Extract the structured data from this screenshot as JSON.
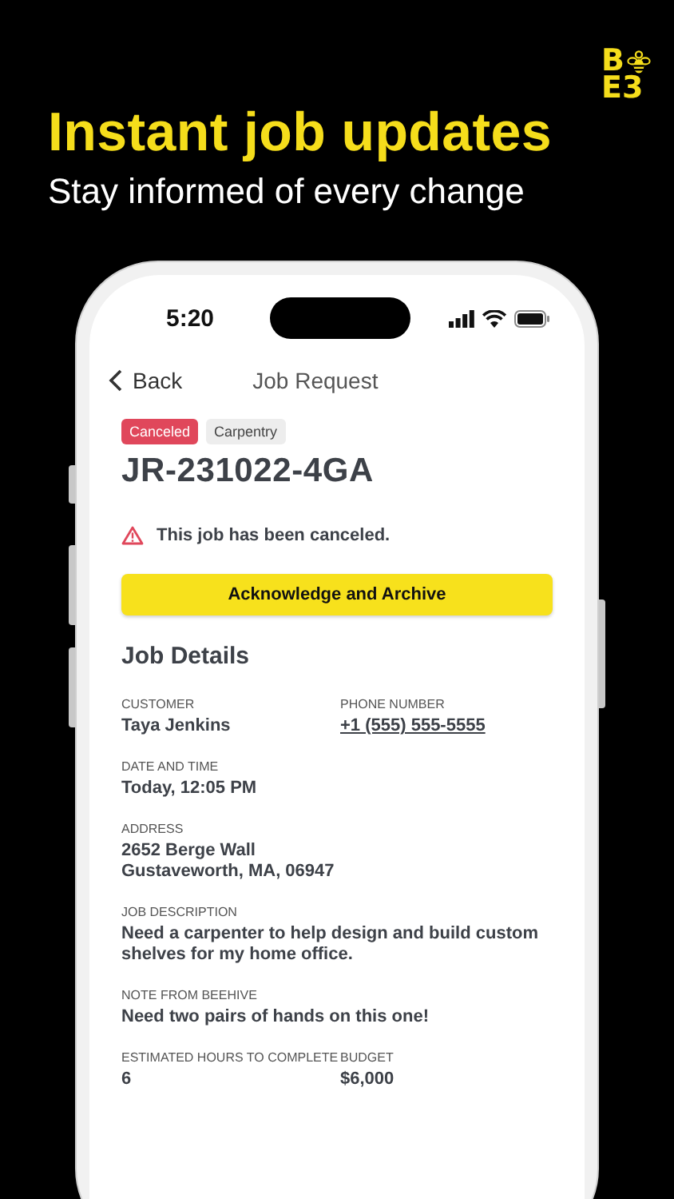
{
  "logo": {
    "top": "B",
    "bottom": "E3"
  },
  "headline": "Instant job updates",
  "subheadline": "Stay informed of every change",
  "status_bar": {
    "time": "5:20"
  },
  "nav": {
    "back": "Back",
    "title": "Job Request"
  },
  "tags": [
    {
      "label": "Canceled",
      "kind": "status"
    },
    {
      "label": "Carpentry",
      "kind": "category"
    }
  ],
  "job_id": "JR-231022-4GA",
  "alert": "This job has been canceled.",
  "action_button": "Acknowledge and Archive",
  "section_title": "Job Details",
  "detail_rows": [
    [
      {
        "label": "CUSTOMER",
        "value": "Taya Jenkins",
        "kind": "text"
      },
      {
        "label": "PHONE NUMBER",
        "value": "+1 (555) 555-5555",
        "kind": "link"
      }
    ],
    [
      {
        "label": "DATE AND TIME",
        "value": "Today, 12:05 PM",
        "kind": "text"
      }
    ],
    [
      {
        "label": "ADDRESS",
        "value": "2652 Berge Wall\nGustaveworth, MA, 06947",
        "kind": "text"
      }
    ],
    [
      {
        "label": "JOB DESCRIPTION",
        "value": "Need a carpenter to help design and build custom shelves for my home office.",
        "kind": "text"
      }
    ],
    [
      {
        "label": "NOTE FROM BEEHIVE",
        "value": "Need two pairs of hands on this one!",
        "kind": "text"
      }
    ],
    [
      {
        "label": "ESTIMATED HOURS TO COMPLETE",
        "value": "6",
        "kind": "text"
      },
      {
        "label": "BUDGET",
        "value": "$6,000",
        "kind": "text"
      }
    ]
  ]
}
